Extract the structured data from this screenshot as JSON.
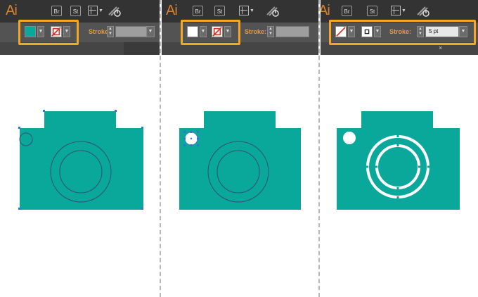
{
  "colors": {
    "teal": "#0aa89a",
    "accent_highlight": "#f5a623",
    "toolbar": "#535353",
    "appbar": "#333333"
  },
  "panels": [
    {
      "app_icon": "Ai",
      "bridge_label": "Br",
      "stock_label": "St",
      "arrange_icon": "arrange-documents-icon",
      "sync_icon": "sync-icon",
      "fill_swatch": {
        "state": "teal",
        "color": "#0aa89a"
      },
      "stroke_swatch": {
        "state": "none"
      },
      "stroke_label": "Stroke:",
      "stroke_weight": ""
    },
    {
      "app_icon": "Ai",
      "bridge_label": "Br",
      "stock_label": "St",
      "arrange_icon": "arrange-documents-icon",
      "sync_icon": "sync-icon",
      "fill_swatch": {
        "state": "white",
        "color": "#ffffff"
      },
      "stroke_swatch": {
        "state": "none"
      },
      "stroke_label": "Stroke:",
      "stroke_weight": ""
    },
    {
      "app_icon": "Ai",
      "bridge_label": "Br",
      "stock_label": "St",
      "arrange_icon": "arrange-documents-icon",
      "sync_icon": "sync-icon",
      "fill_swatch": {
        "state": "none"
      },
      "stroke_swatch": {
        "state": "white",
        "color": "#ffffff"
      },
      "stroke_label": "Stroke:",
      "stroke_weight": "5 pt",
      "close_glyph": "×"
    }
  ]
}
